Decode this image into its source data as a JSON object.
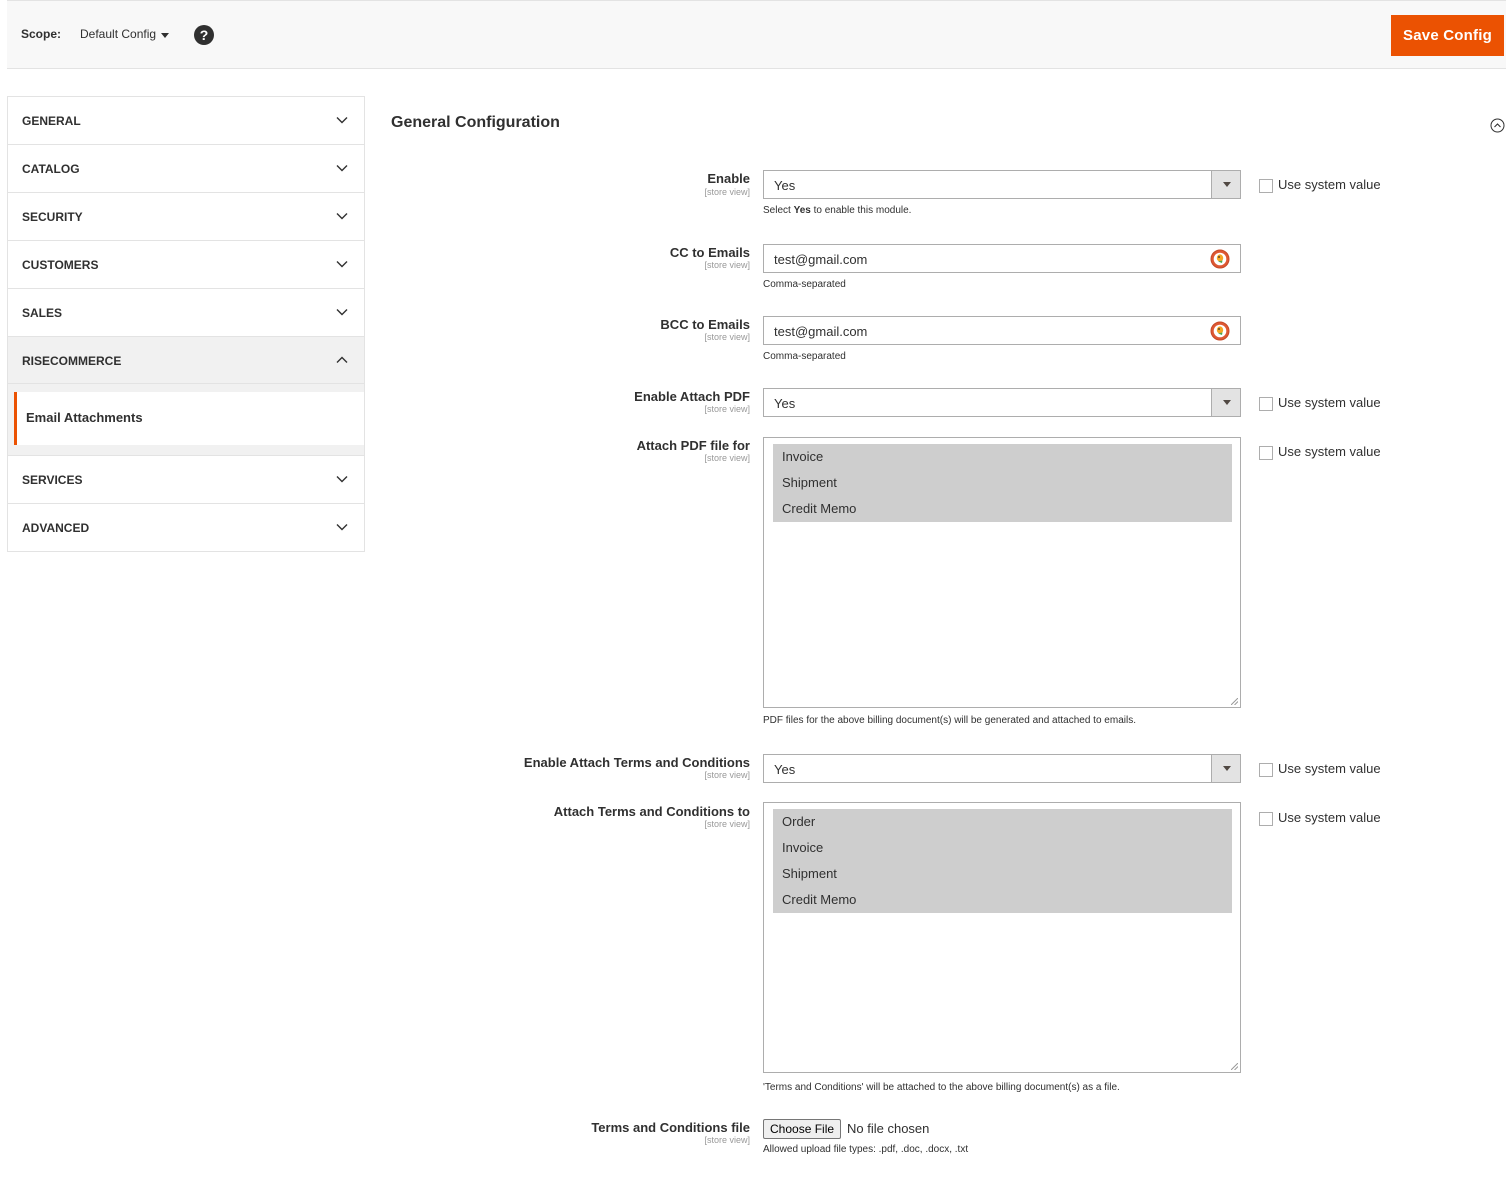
{
  "header": {
    "scope_label": "Scope:",
    "scope_value": "Default Config",
    "help_icon": "question-circle-icon",
    "help_glyph": "?",
    "save_label": "Save Config",
    "accent_color": "#eb5202"
  },
  "sidebar": {
    "items": [
      {
        "label": "GENERAL"
      },
      {
        "label": "CATALOG"
      },
      {
        "label": "SECURITY"
      },
      {
        "label": "CUSTOMERS"
      },
      {
        "label": "SALES"
      },
      {
        "label": "RISECOMMERCE"
      },
      {
        "label": "SERVICES"
      },
      {
        "label": "ADVANCED"
      }
    ],
    "sub_item": "Email Attachments"
  },
  "main": {
    "section_title": "General Configuration",
    "scope_tag": "[store view]",
    "use_system_value": "Use system value",
    "fields": {
      "enable": {
        "label": "Enable",
        "value": "Yes",
        "note_pre": "Select ",
        "note_bold": "Yes",
        "note_post": " to enable this module."
      },
      "cc": {
        "label": "CC to Emails",
        "value": "test@gmail.com",
        "note": "Comma-separated"
      },
      "bcc": {
        "label": "BCC to Emails",
        "value": "test@gmail.com",
        "note": "Comma-separated"
      },
      "attach_pdf": {
        "label": "Enable Attach PDF",
        "value": "Yes"
      },
      "pdf_for": {
        "label": "Attach PDF file for",
        "options": [
          "Invoice",
          "Shipment",
          "Credit Memo"
        ],
        "note": "PDF files for the above billing document(s) will be generated and attached to emails."
      },
      "attach_tc": {
        "label": "Enable Attach Terms and Conditions",
        "value": "Yes"
      },
      "tc_to": {
        "label": "Attach Terms and Conditions to",
        "options": [
          "Order",
          "Invoice",
          "Shipment",
          "Credit Memo"
        ],
        "note": "'Terms and Conditions' will be attached to the above billing document(s) as a file."
      },
      "tc_file": {
        "label": "Terms and Conditions file",
        "button": "Choose File",
        "status": "No file chosen",
        "note": "Allowed upload file types: .pdf, .doc, .docx, .txt"
      }
    }
  }
}
